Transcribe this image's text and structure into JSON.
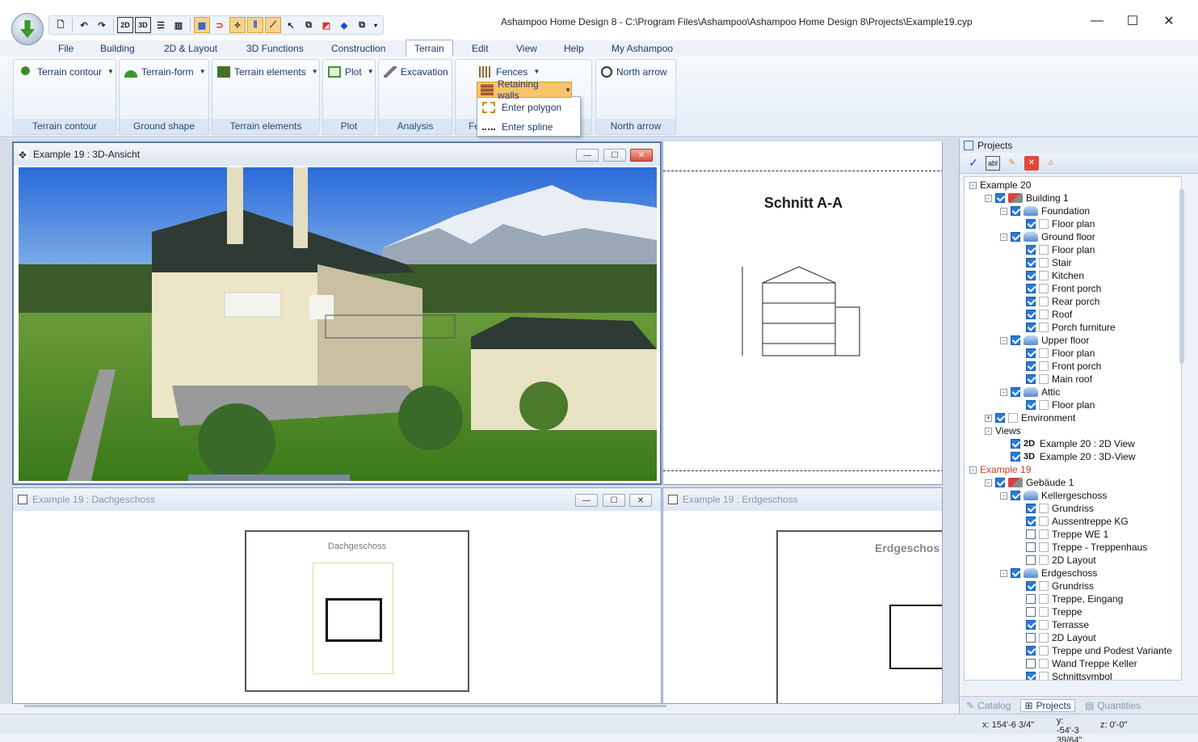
{
  "window": {
    "title": "Ashampoo Home Design 8 - C:\\Program Files\\Ashampoo\\Ashampoo Home Design 8\\Projects\\Example19.cyp",
    "qat": [
      "2D",
      "3D"
    ]
  },
  "tabs": [
    "File",
    "Building",
    "2D & Layout",
    "3D Functions",
    "Construction",
    "Terrain",
    "Edit",
    "View",
    "Help",
    "My Ashampoo"
  ],
  "ribbon": {
    "groups": {
      "terrain_contour": {
        "button": "Terrain contour",
        "caption": "Terrain contour"
      },
      "ground_shape": {
        "button": "Terrain-form",
        "caption": "Ground shape"
      },
      "terrain_elements": {
        "button": "Terrain elements",
        "caption": "Terrain elements"
      },
      "plot": {
        "button": "Plot",
        "caption": "Plot"
      },
      "analysis": {
        "button": "Excavation",
        "caption": "Analysis"
      },
      "fences": {
        "button": "Fences",
        "button2": "Retaining walls",
        "caption": "Fe"
      },
      "north": {
        "button": "North arrow",
        "caption": "North arrow"
      }
    },
    "dropdown": [
      "Enter polygon",
      "Enter spline"
    ]
  },
  "views": {
    "view3d": {
      "title": "Example 19 : 3D-Ansicht"
    },
    "section": {
      "title": "Schnitt A-A"
    },
    "roof": {
      "title": "Example 19 : Dachgeschoss",
      "plan_label": "Dachgeschoss"
    },
    "ground": {
      "title": "Example 19 : Erdgeschoss",
      "plan_label": "Erdgeschos"
    }
  },
  "panel": {
    "title": "Projects",
    "toolbar_label": "abl",
    "tree": [
      {
        "label": "Example 20",
        "level": 0,
        "exp": "-",
        "cb": null,
        "icon": null
      },
      {
        "label": "Building 1",
        "level": 1,
        "exp": "-",
        "cb": true,
        "icon": "building"
      },
      {
        "label": "Foundation",
        "level": 2,
        "exp": "-",
        "cb": true,
        "icon": "level"
      },
      {
        "label": "Floor plan",
        "level": 3,
        "exp": null,
        "cb": true,
        "icon": "file"
      },
      {
        "label": "Ground floor",
        "level": 2,
        "exp": "-",
        "cb": true,
        "icon": "level"
      },
      {
        "label": "Floor plan",
        "level": 3,
        "exp": null,
        "cb": true,
        "icon": "file"
      },
      {
        "label": "Stair",
        "level": 3,
        "exp": null,
        "cb": true,
        "icon": "file"
      },
      {
        "label": "Kitchen",
        "level": 3,
        "exp": null,
        "cb": true,
        "icon": "file"
      },
      {
        "label": "Front porch",
        "level": 3,
        "exp": null,
        "cb": true,
        "icon": "file"
      },
      {
        "label": "Rear porch",
        "level": 3,
        "exp": null,
        "cb": true,
        "icon": "file"
      },
      {
        "label": "Roof",
        "level": 3,
        "exp": null,
        "cb": true,
        "icon": "file"
      },
      {
        "label": "Porch furniture",
        "level": 3,
        "exp": null,
        "cb": true,
        "icon": "file"
      },
      {
        "label": "Upper floor",
        "level": 2,
        "exp": "-",
        "cb": true,
        "icon": "level"
      },
      {
        "label": "Floor plan",
        "level": 3,
        "exp": null,
        "cb": true,
        "icon": "file"
      },
      {
        "label": "Front porch",
        "level": 3,
        "exp": null,
        "cb": true,
        "icon": "file"
      },
      {
        "label": "Main roof",
        "level": 3,
        "exp": null,
        "cb": true,
        "icon": "file"
      },
      {
        "label": "Attic",
        "level": 2,
        "exp": "-",
        "cb": true,
        "icon": "level"
      },
      {
        "label": "Floor plan",
        "level": 3,
        "exp": null,
        "cb": true,
        "icon": "file"
      },
      {
        "label": "Environment",
        "level": 1,
        "exp": "+",
        "cb": true,
        "icon": "file"
      },
      {
        "label": "Views",
        "level": 1,
        "exp": "-",
        "cb": null,
        "icon": null
      },
      {
        "label": "Example 20 : 2D View",
        "level": 2,
        "exp": null,
        "cb": true,
        "icon": "2D"
      },
      {
        "label": "Example 20 : 3D-View",
        "level": 2,
        "exp": null,
        "cb": true,
        "icon": "3D"
      },
      {
        "label": "Example 19",
        "level": 0,
        "exp": "-",
        "cb": null,
        "icon": null,
        "red": true
      },
      {
        "label": "Gebäude 1",
        "level": 1,
        "exp": "-",
        "cb": true,
        "icon": "building"
      },
      {
        "label": "Kellergeschoss",
        "level": 2,
        "exp": "-",
        "cb": true,
        "icon": "level"
      },
      {
        "label": "Grundriss",
        "level": 3,
        "exp": null,
        "cb": true,
        "icon": "file"
      },
      {
        "label": "Aussentreppe KG",
        "level": 3,
        "exp": null,
        "cb": true,
        "icon": "file"
      },
      {
        "label": "Treppe WE 1",
        "level": 3,
        "exp": null,
        "cb": false,
        "icon": "file"
      },
      {
        "label": "Treppe - Treppenhaus",
        "level": 3,
        "exp": null,
        "cb": false,
        "icon": "file"
      },
      {
        "label": "2D Layout",
        "level": 3,
        "exp": null,
        "cb": false,
        "icon": "file"
      },
      {
        "label": "Erdgeschoss",
        "level": 2,
        "exp": "-",
        "cb": true,
        "icon": "level"
      },
      {
        "label": "Grundriss",
        "level": 3,
        "exp": null,
        "cb": true,
        "icon": "file"
      },
      {
        "label": "Treppe, Eingang",
        "level": 3,
        "exp": null,
        "cb": false,
        "icon": "file"
      },
      {
        "label": "Treppe",
        "level": 3,
        "exp": null,
        "cb": false,
        "icon": "file"
      },
      {
        "label": "Terrasse",
        "level": 3,
        "exp": null,
        "cb": true,
        "icon": "file"
      },
      {
        "label": "2D Layout",
        "level": 3,
        "exp": null,
        "cb": false,
        "icon": "file"
      },
      {
        "label": "Treppe und Podest Variante",
        "level": 3,
        "exp": null,
        "cb": true,
        "icon": "file"
      },
      {
        "label": "Wand Treppe Keller",
        "level": 3,
        "exp": null,
        "cb": false,
        "icon": "file"
      },
      {
        "label": "Schnittsymbol",
        "level": 3,
        "exp": null,
        "cb": true,
        "icon": "file"
      }
    ],
    "bottom_tabs": [
      "Catalog",
      "Projects",
      "Quantities"
    ]
  },
  "status": {
    "x": "x: 154'-6 3/4\"",
    "y": "y: -54'-3 39/64\"",
    "z": "z: 0'-0\""
  },
  "colors": {
    "accent": "#f7c46a",
    "ribbon": "#dbe6f4",
    "checkbox": "#2a7ad8"
  }
}
